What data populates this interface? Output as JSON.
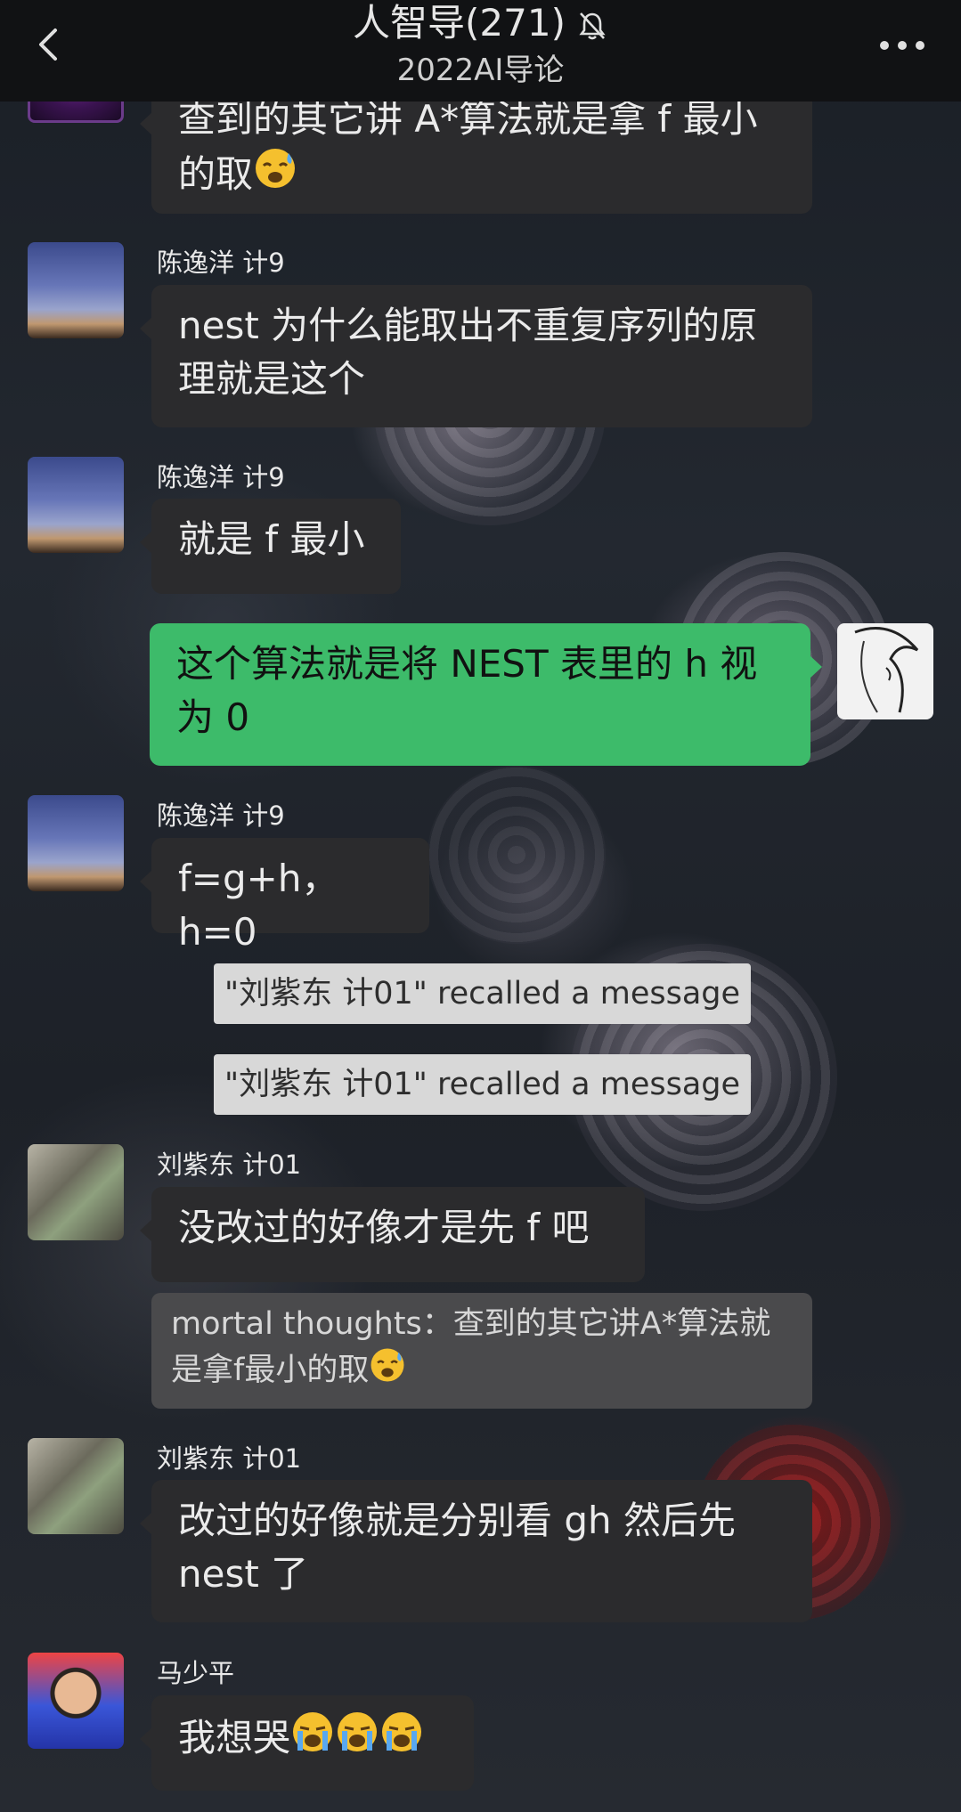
{
  "header": {
    "title": "人智导(271)",
    "subtitle": "2022AI导论"
  },
  "messages": [
    {
      "type": "incoming",
      "sender": "",
      "text": "查到的其它讲 A*算法就是拿 f 最小的取",
      "emoji": "face-with-open-mouth-sweat"
    },
    {
      "type": "incoming",
      "sender": "陈逸洋 计9",
      "text": "nest 为什么能取出不重复序列的原理就是这个"
    },
    {
      "type": "incoming",
      "sender": "陈逸洋 计9",
      "text": "就是 f 最小"
    },
    {
      "type": "outgoing",
      "sender": "",
      "text": "这个算法就是将 NEST 表里的 h 视为 0"
    },
    {
      "type": "incoming",
      "sender": "陈逸洋 计9",
      "text": "f=g+h，h=0"
    },
    {
      "type": "system",
      "text": "\"刘紫东 计01\" recalled a message"
    },
    {
      "type": "system",
      "text": "\"刘紫东 计01\" recalled a message"
    },
    {
      "type": "incoming",
      "sender": "刘紫东 计01",
      "text": "没改过的好像才是先 f 吧",
      "quote": "mortal thoughts：查到的其它讲A*算法就是拿f最小的取"
    },
    {
      "type": "incoming",
      "sender": "刘紫东 计01",
      "text": "改过的好像就是分别看 gh 然后先 nest 了"
    },
    {
      "type": "incoming",
      "sender": "马少平",
      "text": "我想哭",
      "emoji": "loudly-crying-face x3"
    }
  ],
  "colors": {
    "header_bg": "#111214",
    "incoming_bubble": "#2b2b2d",
    "outgoing_bubble": "#3dbb6a",
    "system_notice": "#d8d8d8"
  },
  "icons": [
    "back-arrow-icon",
    "mute-bell-icon",
    "more-dots-icon"
  ]
}
